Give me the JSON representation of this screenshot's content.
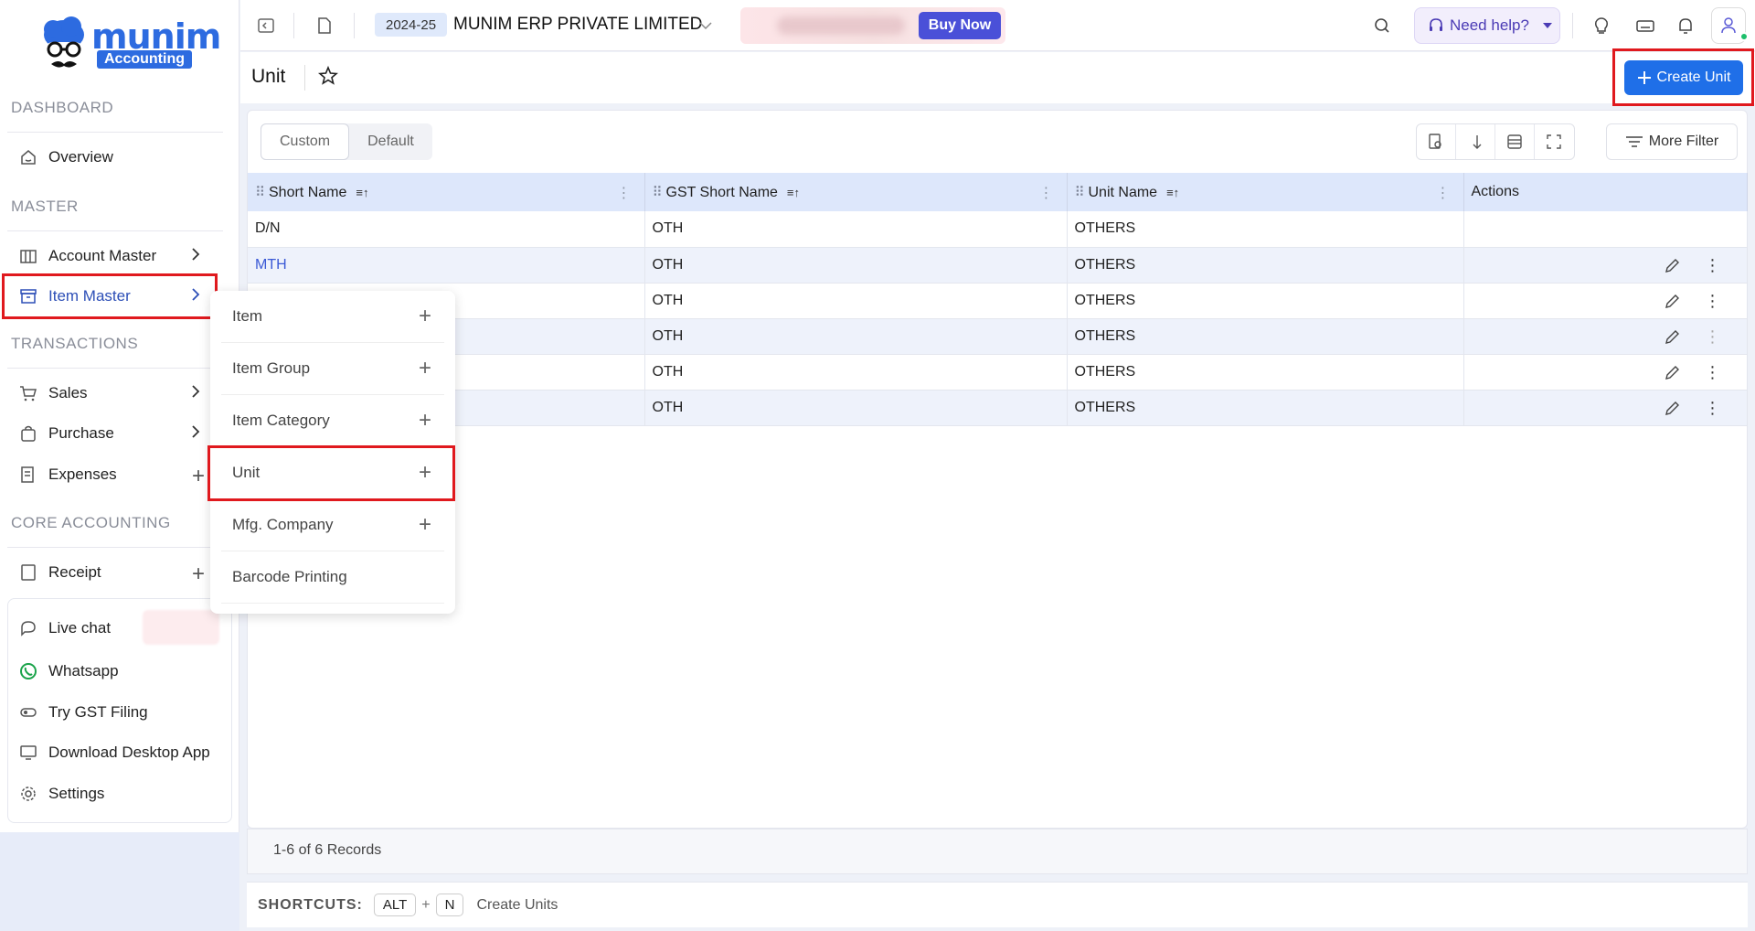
{
  "brand": {
    "name": "munim",
    "sub": "Accounting"
  },
  "sidebar": {
    "sections": {
      "dashboard": "DASHBOARD",
      "master": "MASTER",
      "transactions": "TRANSACTIONS",
      "core": "CORE ACCOUNTING"
    },
    "items": {
      "overview": "Overview",
      "account_master": "Account Master",
      "item_master": "Item Master",
      "sales": "Sales",
      "purchase": "Purchase",
      "expenses": "Expenses",
      "receipt": "Receipt",
      "live_chat": "Live chat",
      "whatsapp": "Whatsapp",
      "gst_filing": "Try GST Filing",
      "desktop_app": "Download Desktop App",
      "settings": "Settings"
    }
  },
  "flyout": {
    "items": [
      "Item",
      "Item Group",
      "Item Category",
      "Unit",
      "Mfg. Company",
      "Barcode Printing"
    ]
  },
  "topbar": {
    "fy": "2024-25",
    "company": "MUNIM ERP PRIVATE LIMITED",
    "buy_now": "Buy Now",
    "help": "Need help?"
  },
  "page": {
    "title": "Unit",
    "create_label": "Create Unit"
  },
  "toolbar": {
    "tabs": [
      "Custom",
      "Default"
    ],
    "more_filter": "More Filter"
  },
  "table": {
    "columns": [
      "Short Name",
      "GST Short Name",
      "Unit Name",
      "Actions"
    ],
    "rows": [
      [
        "D/N",
        "OTH",
        "OTHERS"
      ],
      [
        "MTH",
        "OTH",
        "OTHERS"
      ],
      [
        "",
        "OTH",
        "OTHERS"
      ],
      [
        "",
        "OTH",
        "OTHERS"
      ],
      [
        "",
        "OTH",
        "OTHERS"
      ],
      [
        "",
        "OTH",
        "OTHERS"
      ]
    ]
  },
  "footer": {
    "records": "1-6 of 6 Records",
    "shortcuts_label": "SHORTCUTS:",
    "key1": "ALT",
    "plus": "+",
    "key2": "N",
    "shortcut_desc": "Create Units"
  },
  "colors": {
    "accent": "#1f6fe8",
    "highlight": "#e0191e",
    "header_row": "#dde7fb"
  }
}
